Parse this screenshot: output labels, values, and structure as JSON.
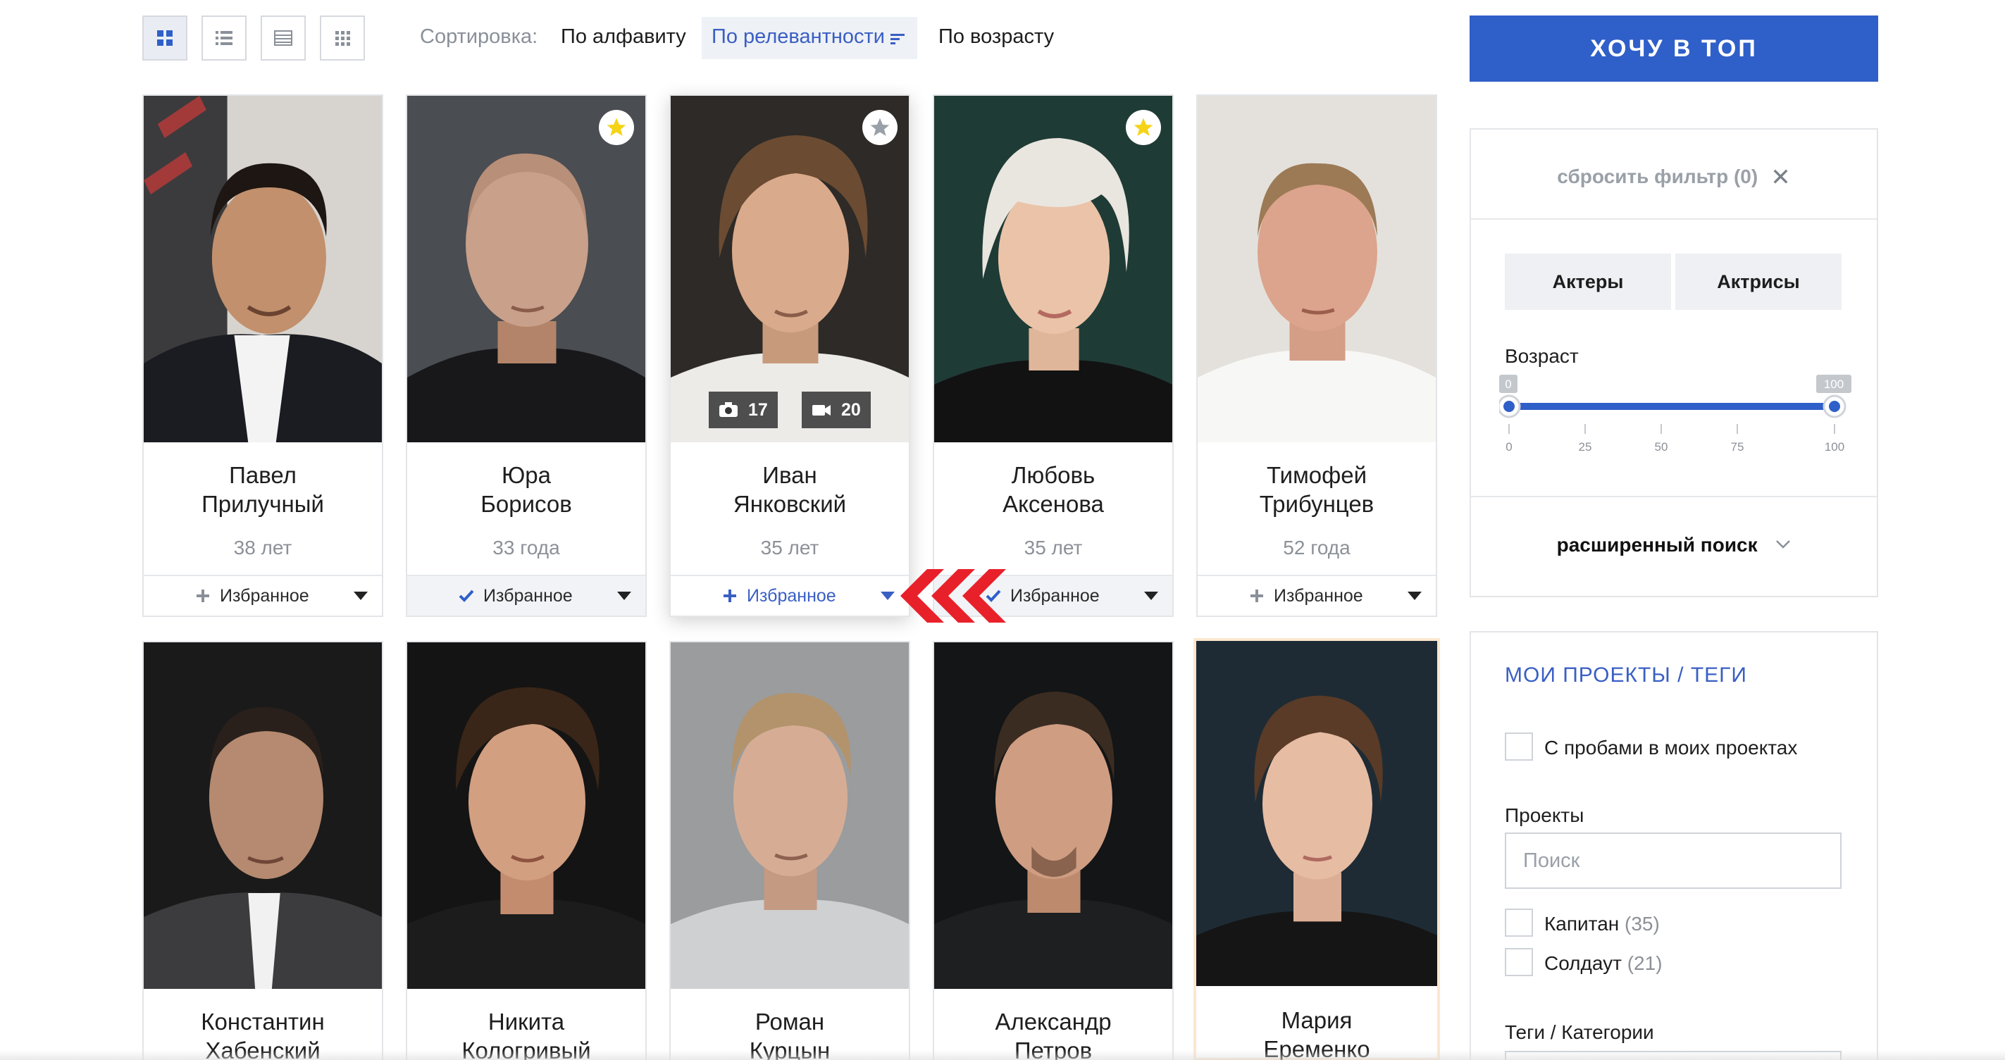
{
  "toolbar": {
    "views": [
      {
        "icon": "grid-large-icon",
        "active": true
      },
      {
        "icon": "list-icon",
        "active": false
      },
      {
        "icon": "rows-icon",
        "active": false
      },
      {
        "icon": "grid-small-icon",
        "active": false
      }
    ],
    "sort_label": "Сортировка:",
    "sort_options": [
      "По алфавиту",
      "По релевантности",
      "По возрасту"
    ],
    "sort_active": "По релевантности"
  },
  "cards": [
    {
      "first": "Павел",
      "last": "Прилучный",
      "age": "38 лет",
      "fav_label": "Избранное",
      "fav_state": "plus",
      "star": false
    },
    {
      "first": "Юра",
      "last": "Борисов",
      "age": "33 года",
      "fav_label": "Избранное",
      "fav_state": "check",
      "star": true
    },
    {
      "first": "Иван",
      "last": "Янковский",
      "age": "35 лет",
      "fav_label": "Избранное",
      "fav_state": "plus-blue",
      "star": true,
      "photos": "17",
      "videos": "20"
    },
    {
      "first": "Любовь",
      "last": "Аксенова",
      "age": "35 лет",
      "fav_label": "Избранное",
      "fav_state": "check",
      "star": true
    },
    {
      "first": "Тимофей",
      "last": "Трибунцев",
      "age": "52 года",
      "fav_label": "Избранное",
      "fav_state": "plus",
      "star": false
    },
    {
      "first": "Константин",
      "last": "Хабенский"
    },
    {
      "first": "Никита",
      "last": "Кологривый"
    },
    {
      "first": "Роман",
      "last": "Курцын"
    },
    {
      "first": "Александр",
      "last": "Петров"
    },
    {
      "first": "Мария",
      "last": "Еременко"
    }
  ],
  "sidebar": {
    "top_button": "ХОЧУ В ТОП",
    "reset": "сбросить фильтр (0)",
    "genders": [
      "Актеры",
      "Актрисы"
    ],
    "age_label": "Возраст",
    "age_min": "0",
    "age_max": "100",
    "age_ticks": [
      "0",
      "25",
      "50",
      "75",
      "100"
    ],
    "advanced": "расширенный поиск",
    "projects_title": "МОИ ПРОЕКТЫ / ТЕГИ",
    "trials_label": "С пробами в моих проектах",
    "projects_label": "Проекты",
    "search_placeholder": "Поиск",
    "projects": [
      {
        "name": "Капитан",
        "count": "(35)"
      },
      {
        "name": "Солдаут",
        "count": "(21)"
      }
    ],
    "tags_label": "Теги / Категории"
  },
  "colors": {
    "accent": "#2f5fc8",
    "link": "#3a5fc4",
    "star": "#f5d316",
    "arrow": "#e8202a"
  }
}
